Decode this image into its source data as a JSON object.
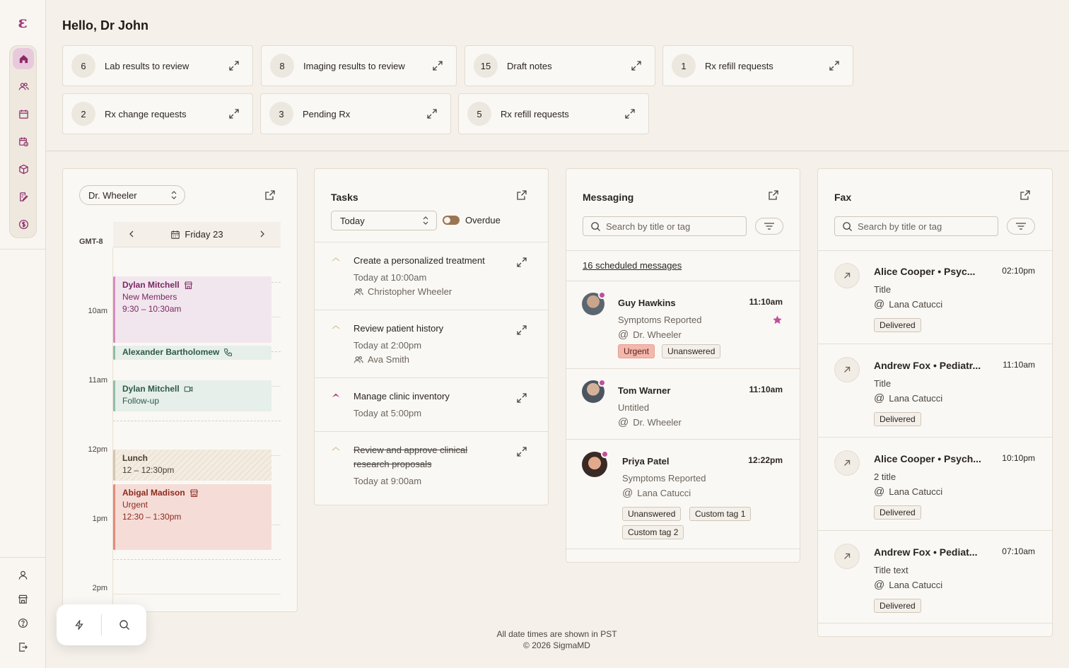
{
  "greeting": "Hello, Dr John",
  "stats": [
    {
      "count": "6",
      "label": "Lab results to review"
    },
    {
      "count": "8",
      "label": "Imaging results to review"
    },
    {
      "count": "15",
      "label": "Draft notes"
    },
    {
      "count": "1",
      "label": "Rx refill requests"
    },
    {
      "count": "2",
      "label": "Rx change requests"
    },
    {
      "count": "3",
      "label": "Pending Rx"
    },
    {
      "count": "5",
      "label": "Rx refill requests"
    }
  ],
  "calendar": {
    "provider": "Dr. Wheeler",
    "date": "Friday 23",
    "timezone": "GMT-8",
    "hours": [
      "10am",
      "11am",
      "12pm",
      "1pm",
      "2pm"
    ],
    "events": [
      {
        "name": "Dylan Mitchell",
        "line1": "New Members",
        "line2": "9:30 – 10:30am"
      },
      {
        "name": "Alexander Bartholomew"
      },
      {
        "name": "Dylan Mitchell",
        "line1": "Follow-up"
      },
      {
        "name": "Lunch",
        "line1": "12 – 12:30pm"
      },
      {
        "name": "Abigal Madison",
        "line1": "Urgent",
        "line2": "12:30 – 1:30pm"
      }
    ]
  },
  "tasks": {
    "title": "Tasks",
    "filter": "Today",
    "overdue_label": "Overdue",
    "items": [
      {
        "title": "Create a personalized treatment",
        "due": "Today at 10:00am",
        "person": "Christopher Wheeler"
      },
      {
        "title": "Review patient history",
        "due": "Today at 2:00pm",
        "person": "Ava Smith"
      },
      {
        "title": "Manage clinic inventory",
        "due": "Today at 5:00pm"
      },
      {
        "title": "Review and approve clinical research proposals",
        "due": "Today at 9:00am"
      }
    ]
  },
  "messaging": {
    "title": "Messaging",
    "search_placeholder": "Search by title or tag",
    "scheduled": "16 scheduled messages",
    "items": [
      {
        "name": "Guy Hawkins",
        "time": "11:10am",
        "subject": "Symptoms Reported",
        "to": "Dr. Wheeler",
        "tags": [
          "Urgent",
          "Unanswered"
        ]
      },
      {
        "name": "Tom Warner",
        "time": "11:10am",
        "subject": "Untitled",
        "to": "Dr. Wheeler",
        "tags": []
      },
      {
        "name": "Priya Patel",
        "time": "12:22pm",
        "subject": "Symptoms Reported",
        "to": "Lana Catucci",
        "tags": [
          "Unanswered",
          "Custom tag 1",
          "Custom tag 2"
        ]
      }
    ]
  },
  "fax": {
    "title": "Fax",
    "search_placeholder": "Search by title or tag",
    "items": [
      {
        "name": "Alice Cooper • Psyc...",
        "time": "02:10pm",
        "subject": "Title",
        "to": "Lana Catucci",
        "status": "Delivered"
      },
      {
        "name": "Andrew Fox • Pediatr...",
        "time": "11:10am",
        "subject": "Title",
        "to": "Lana Catucci",
        "status": "Delivered"
      },
      {
        "name": "Alice Cooper • Psych...",
        "time": "10:10pm",
        "subject": "2 title",
        "to": "Lana Catucci",
        "status": "Delivered"
      },
      {
        "name": "Andrew Fox • Pediat...",
        "time": "07:10am",
        "subject": "Title text",
        "to": "Lana Catucci",
        "status": "Delivered"
      }
    ]
  },
  "footer": {
    "line1": "All date times are shown in PST",
    "line2": "© 2026 SigmaMD"
  },
  "colors": {
    "accent": "#a33b7d",
    "background": "#f5f1ea",
    "card": "#faf8f4",
    "urgent_tag": "#f2b8ad"
  }
}
